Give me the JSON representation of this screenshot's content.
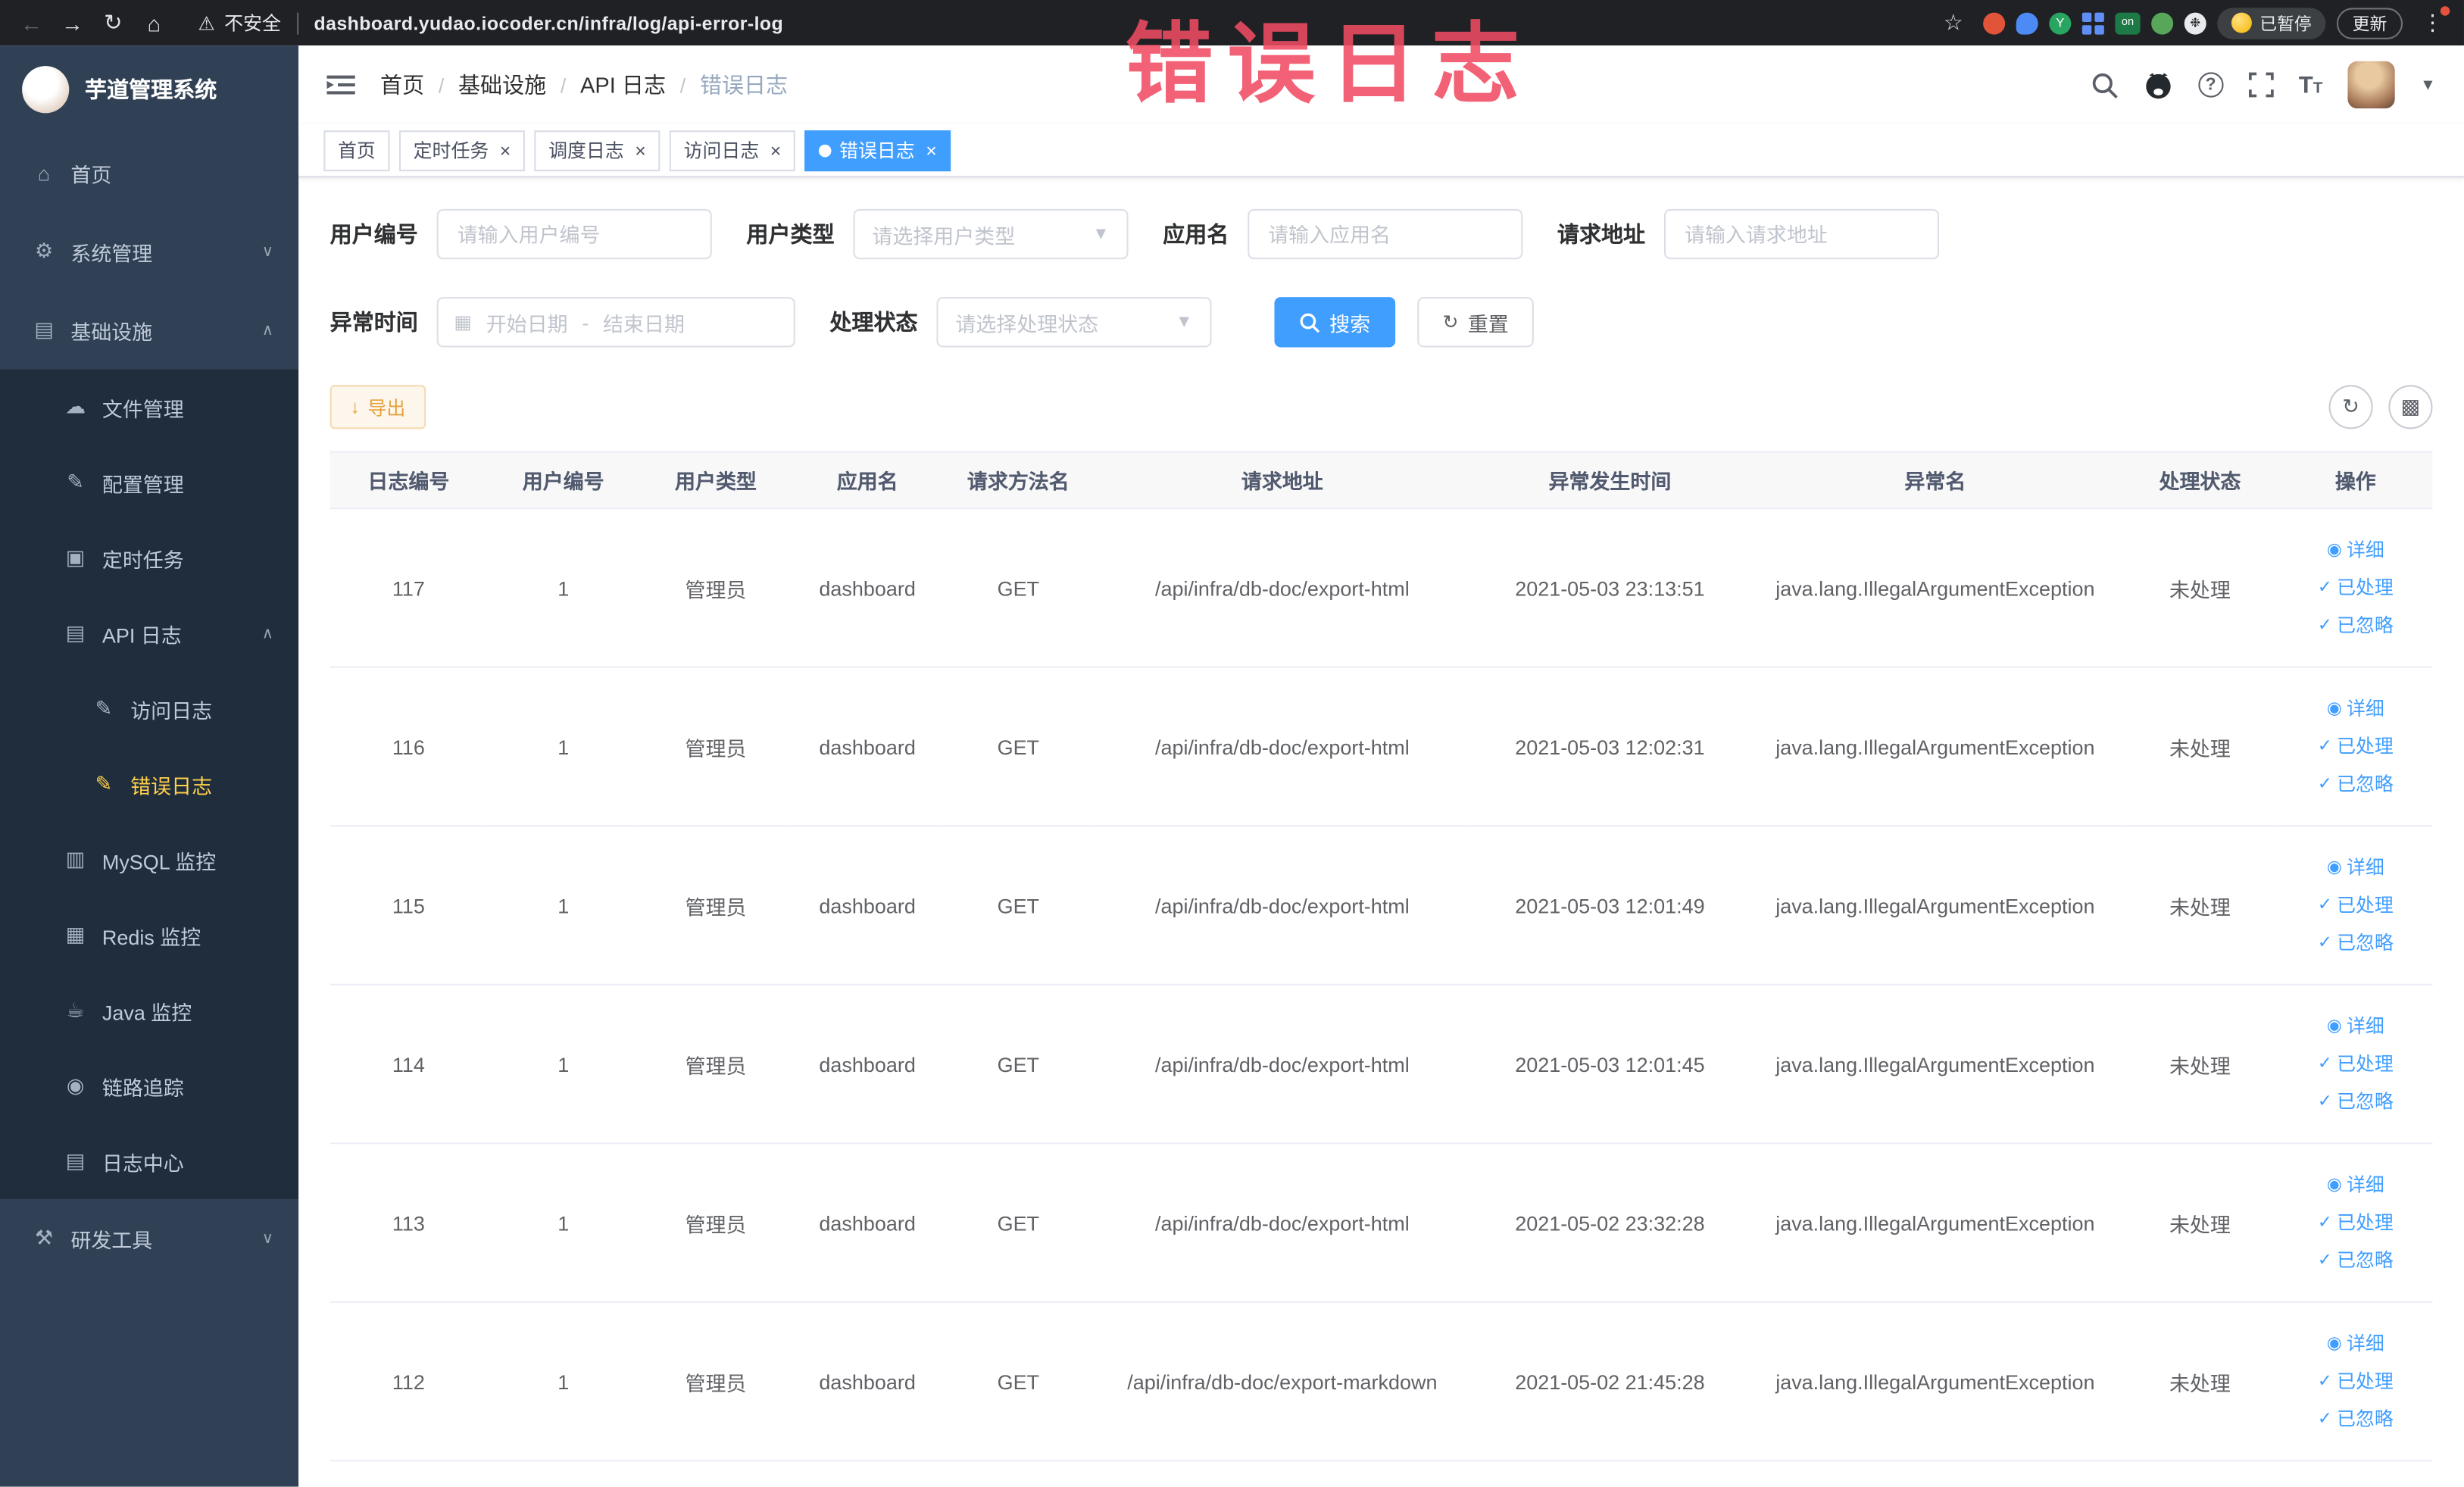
{
  "colors": {
    "accent": "#409eff",
    "warning": "#e6a23c",
    "sidebar_bg": "#304156",
    "sidebar_sub_bg": "#1f2d3d",
    "sidebar_active": "#ffd04b",
    "link": "#409eff",
    "overlay_red": "#f04b62"
  },
  "overlay": {
    "title": "错误日志"
  },
  "browser": {
    "security_text": "不安全",
    "url": "dashboard.yudao.iocoder.cn/infra/log/api-error-log",
    "paused_badge": "已暂停",
    "update_button": "更新"
  },
  "sidebar": {
    "title": "芋道管理系统",
    "items": [
      {
        "key": "home",
        "label": "首页",
        "icon": "home-icon",
        "level": 1
      },
      {
        "key": "system-mgmt",
        "label": "系统管理",
        "icon": "gear-icon",
        "level": 1,
        "arrow": "down"
      },
      {
        "key": "infra",
        "label": "基础设施",
        "icon": "infra-icon",
        "level": 1,
        "arrow": "up"
      },
      {
        "key": "file-mgmt",
        "label": "文件管理",
        "icon": "cloud-icon",
        "level": 2
      },
      {
        "key": "config-mgmt",
        "label": "配置管理",
        "icon": "edit-icon",
        "level": 2
      },
      {
        "key": "scheduled-jobs",
        "label": "定时任务",
        "icon": "job-icon",
        "level": 2
      },
      {
        "key": "api-log",
        "label": "API 日志",
        "icon": "api-log-icon",
        "level": 2,
        "arrow": "up"
      },
      {
        "key": "access-log",
        "label": "访问日志",
        "icon": "doc-edit-icon",
        "level": 3
      },
      {
        "key": "error-log",
        "label": "错误日志",
        "icon": "doc-edit-icon",
        "level": 3,
        "active": true
      },
      {
        "key": "mysql-monitor",
        "label": "MySQL 监控",
        "icon": "mysql-icon",
        "level": 2
      },
      {
        "key": "redis-monitor",
        "label": "Redis 监控",
        "icon": "redis-icon",
        "level": 2
      },
      {
        "key": "java-monitor",
        "label": "Java 监控",
        "icon": "java-icon",
        "level": 2
      },
      {
        "key": "trace",
        "label": "链路追踪",
        "icon": "trace-icon",
        "level": 2
      },
      {
        "key": "log-center",
        "label": "日志中心",
        "icon": "log-center-icon",
        "level": 2
      },
      {
        "key": "dev-tools",
        "label": "研发工具",
        "icon": "tools-icon",
        "level": 1,
        "arrow": "down"
      }
    ]
  },
  "header": {
    "breadcrumb": [
      "首页",
      "基础设施",
      "API 日志",
      "错误日志"
    ]
  },
  "tags": [
    {
      "label": "首页",
      "closable": false,
      "active": false
    },
    {
      "label": "定时任务",
      "closable": true,
      "active": false
    },
    {
      "label": "调度日志",
      "closable": true,
      "active": false
    },
    {
      "label": "访问日志",
      "closable": true,
      "active": false
    },
    {
      "label": "错误日志",
      "closable": true,
      "active": true
    }
  ],
  "filters": {
    "user_id": {
      "label": "用户编号",
      "placeholder": "请输入用户编号"
    },
    "user_type": {
      "label": "用户类型",
      "placeholder": "请选择用户类型"
    },
    "app_name": {
      "label": "应用名",
      "placeholder": "请输入应用名"
    },
    "request_url": {
      "label": "请求地址",
      "placeholder": "请输入请求地址"
    },
    "exception_time": {
      "label": "异常时间",
      "start_placeholder": "开始日期",
      "separator": "-",
      "end_placeholder": "结束日期"
    },
    "process_status": {
      "label": "处理状态",
      "placeholder": "请选择处理状态"
    },
    "search_button": "搜索",
    "reset_button": "重置"
  },
  "toolbar": {
    "export_button": "导出"
  },
  "table": {
    "columns": [
      "日志编号",
      "用户编号",
      "用户类型",
      "应用名",
      "请求方法名",
      "请求地址",
      "异常发生时间",
      "异常名",
      "处理状态",
      "操作"
    ],
    "actions": [
      "详细",
      "已处理",
      "已忽略"
    ],
    "rows": [
      {
        "id": "117",
        "user_id": "1",
        "user_type": "管理员",
        "app": "dashboard",
        "method": "GET",
        "url": "/api/infra/db-doc/export-html",
        "time": "2021-05-03 23:13:51",
        "exception": "java.lang.IllegalArgumentException",
        "status": "未处理"
      },
      {
        "id": "116",
        "user_id": "1",
        "user_type": "管理员",
        "app": "dashboard",
        "method": "GET",
        "url": "/api/infra/db-doc/export-html",
        "time": "2021-05-03 12:02:31",
        "exception": "java.lang.IllegalArgumentException",
        "status": "未处理"
      },
      {
        "id": "115",
        "user_id": "1",
        "user_type": "管理员",
        "app": "dashboard",
        "method": "GET",
        "url": "/api/infra/db-doc/export-html",
        "time": "2021-05-03 12:01:49",
        "exception": "java.lang.IllegalArgumentException",
        "status": "未处理"
      },
      {
        "id": "114",
        "user_id": "1",
        "user_type": "管理员",
        "app": "dashboard",
        "method": "GET",
        "url": "/api/infra/db-doc/export-html",
        "time": "2021-05-03 12:01:45",
        "exception": "java.lang.IllegalArgumentException",
        "status": "未处理"
      },
      {
        "id": "113",
        "user_id": "1",
        "user_type": "管理员",
        "app": "dashboard",
        "method": "GET",
        "url": "/api/infra/db-doc/export-html",
        "time": "2021-05-02 23:32:28",
        "exception": "java.lang.IllegalArgumentException",
        "status": "未处理"
      },
      {
        "id": "112",
        "user_id": "1",
        "user_type": "管理员",
        "app": "dashboard",
        "method": "GET",
        "url": "/api/infra/db-doc/export-markdown",
        "time": "2021-05-02 21:45:28",
        "exception": "java.lang.IllegalArgumentException",
        "status": "未处理"
      }
    ]
  }
}
